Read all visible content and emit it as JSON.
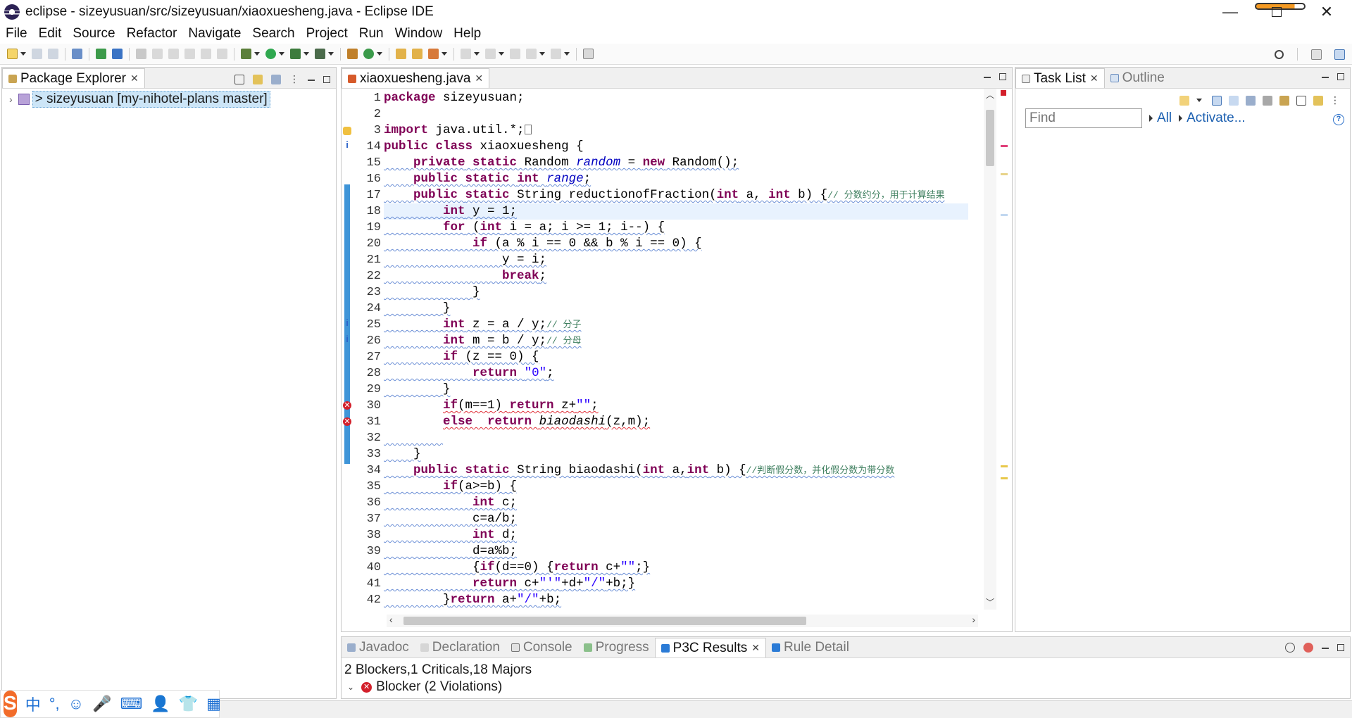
{
  "window": {
    "title": "eclipse - sizeyusuan/src/sizeyusuan/xiaoxuesheng.java - Eclipse IDE",
    "minimize": "—",
    "close": "✕"
  },
  "menu": [
    "File",
    "Edit",
    "Source",
    "Refactor",
    "Navigate",
    "Search",
    "Project",
    "Run",
    "Window",
    "Help"
  ],
  "package_explorer": {
    "tab": "Package Explorer",
    "project": "> sizeyusuan [my-nihotel-plans master]"
  },
  "editor": {
    "tab": "xiaoxuesheng.java",
    "line_numbers": [
      "1",
      "2",
      "3",
      "14",
      "15",
      "16",
      "17",
      "18",
      "19",
      "20",
      "21",
      "22",
      "23",
      "24",
      "25",
      "26",
      "27",
      "28",
      "29",
      "30",
      "31",
      "32",
      "33",
      "34",
      "35",
      "36",
      "37",
      "38",
      "39",
      "40",
      "41",
      "42"
    ]
  },
  "task_list": {
    "tab": "Task List",
    "outline_tab": "Outline",
    "find_placeholder": "Find",
    "all": "All",
    "activate": "Activate..."
  },
  "bottom": {
    "tabs": [
      "Javadoc",
      "Declaration",
      "Console",
      "Progress",
      "P3C Results",
      "Rule Detail"
    ],
    "summary": "2 Blockers,1 Criticals,18 Majors",
    "violation": "Blocker (2 Violations)"
  },
  "ime": {
    "logo": "S",
    "items": [
      "中",
      "°,",
      "☺",
      "🎤",
      "⌨",
      "👤",
      "👕",
      "▦"
    ]
  }
}
